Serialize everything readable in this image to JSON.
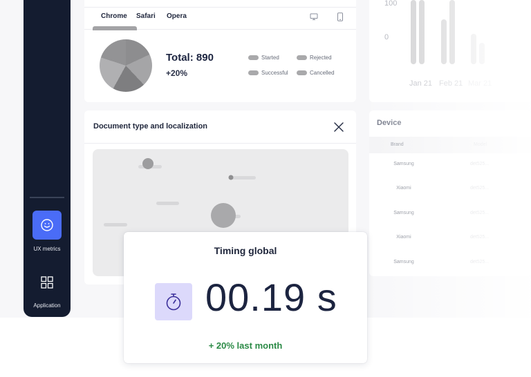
{
  "sidebar": {
    "items": [
      {
        "label": "UX metrics",
        "icon": "smile-icon",
        "active": true
      },
      {
        "label": "Application",
        "icon": "grid-icon",
        "active": false
      }
    ]
  },
  "browser_card": {
    "tabs": [
      "Chrome",
      "Safari",
      "Opera"
    ],
    "selected_tab": "Chrome",
    "device_icons": [
      "desktop-icon",
      "mobile-icon"
    ],
    "total": "Total: 890",
    "delta": "+20%",
    "legend": [
      "Started",
      "Rejected",
      "Successful",
      "Cancelled"
    ]
  },
  "bar_chart": {
    "ticks": [
      "100",
      "0"
    ],
    "months": [
      "Jan 21",
      "Feb 21",
      "Mar 21"
    ]
  },
  "map_card": {
    "title": "Document type and localization"
  },
  "device_card": {
    "title": "Device",
    "columns": [
      "Brand",
      "Model"
    ],
    "rows": [
      {
        "brand": "Samsung",
        "model": "det525..."
      },
      {
        "brand": "Xiaomi",
        "model": "det525..."
      },
      {
        "brand": "Samsung",
        "model": "det525..."
      },
      {
        "brand": "Xiaomi",
        "model": "det525..."
      },
      {
        "brand": "Samsung",
        "model": "det525..."
      }
    ]
  },
  "timing": {
    "title": "Timing global",
    "value": "00.19 s",
    "footer": "+ 20% last month"
  },
  "colors": {
    "sidebar_bg": "#141c30",
    "accent": "#4a6cf7",
    "timer_box": "#dcd9fb",
    "positive": "#2b8a46"
  }
}
